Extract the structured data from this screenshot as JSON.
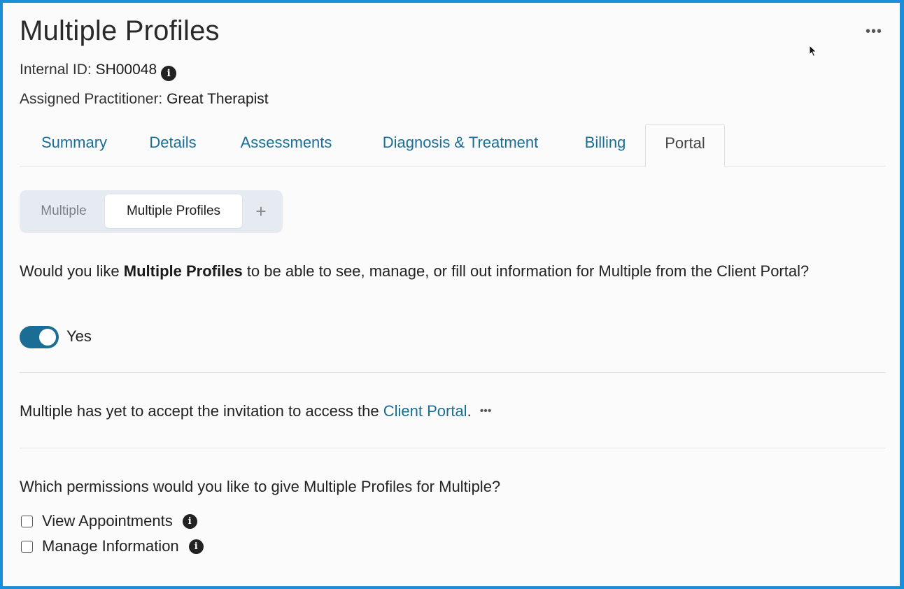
{
  "header": {
    "title": "Multiple Profiles",
    "more_label": "•••",
    "internal_id_label": "Internal ID: ",
    "internal_id_value": "SH00048",
    "practitioner_label": "Assigned Practitioner: ",
    "practitioner_value": "Great Therapist"
  },
  "tabs": [
    {
      "label": "Summary"
    },
    {
      "label": "Details"
    },
    {
      "label": "Assessments"
    },
    {
      "label": "Diagnosis & Treatment"
    },
    {
      "label": "Billing"
    },
    {
      "label": "Portal",
      "active": true
    }
  ],
  "profiles": {
    "items": [
      {
        "label": "Multiple",
        "active": false
      },
      {
        "label": "Multiple Profiles",
        "active": true
      }
    ],
    "add_label": "+"
  },
  "portal_access": {
    "q_part1": "Would you like ",
    "q_bold": "Multiple Profiles",
    "q_part2": " to be able to see, manage, or fill out information for Multiple from the Client Portal?",
    "toggle_on": true,
    "toggle_label": "Yes"
  },
  "invitation": {
    "text": "Multiple has yet to accept the invitation to access the ",
    "link": "Client Portal",
    "suffix": ".",
    "more_label": "•••"
  },
  "permissions": {
    "question": "Which permissions would you like to give Multiple Profiles for Multiple?",
    "items": [
      {
        "label": "View Appointments",
        "checked": false
      },
      {
        "label": "Manage Information",
        "checked": false
      }
    ]
  },
  "colors": {
    "accent": "#1a6e96",
    "frame": "#1a8fd8"
  },
  "icons": [
    "info-icon",
    "more-icon",
    "plus-icon",
    "cursor-icon"
  ]
}
